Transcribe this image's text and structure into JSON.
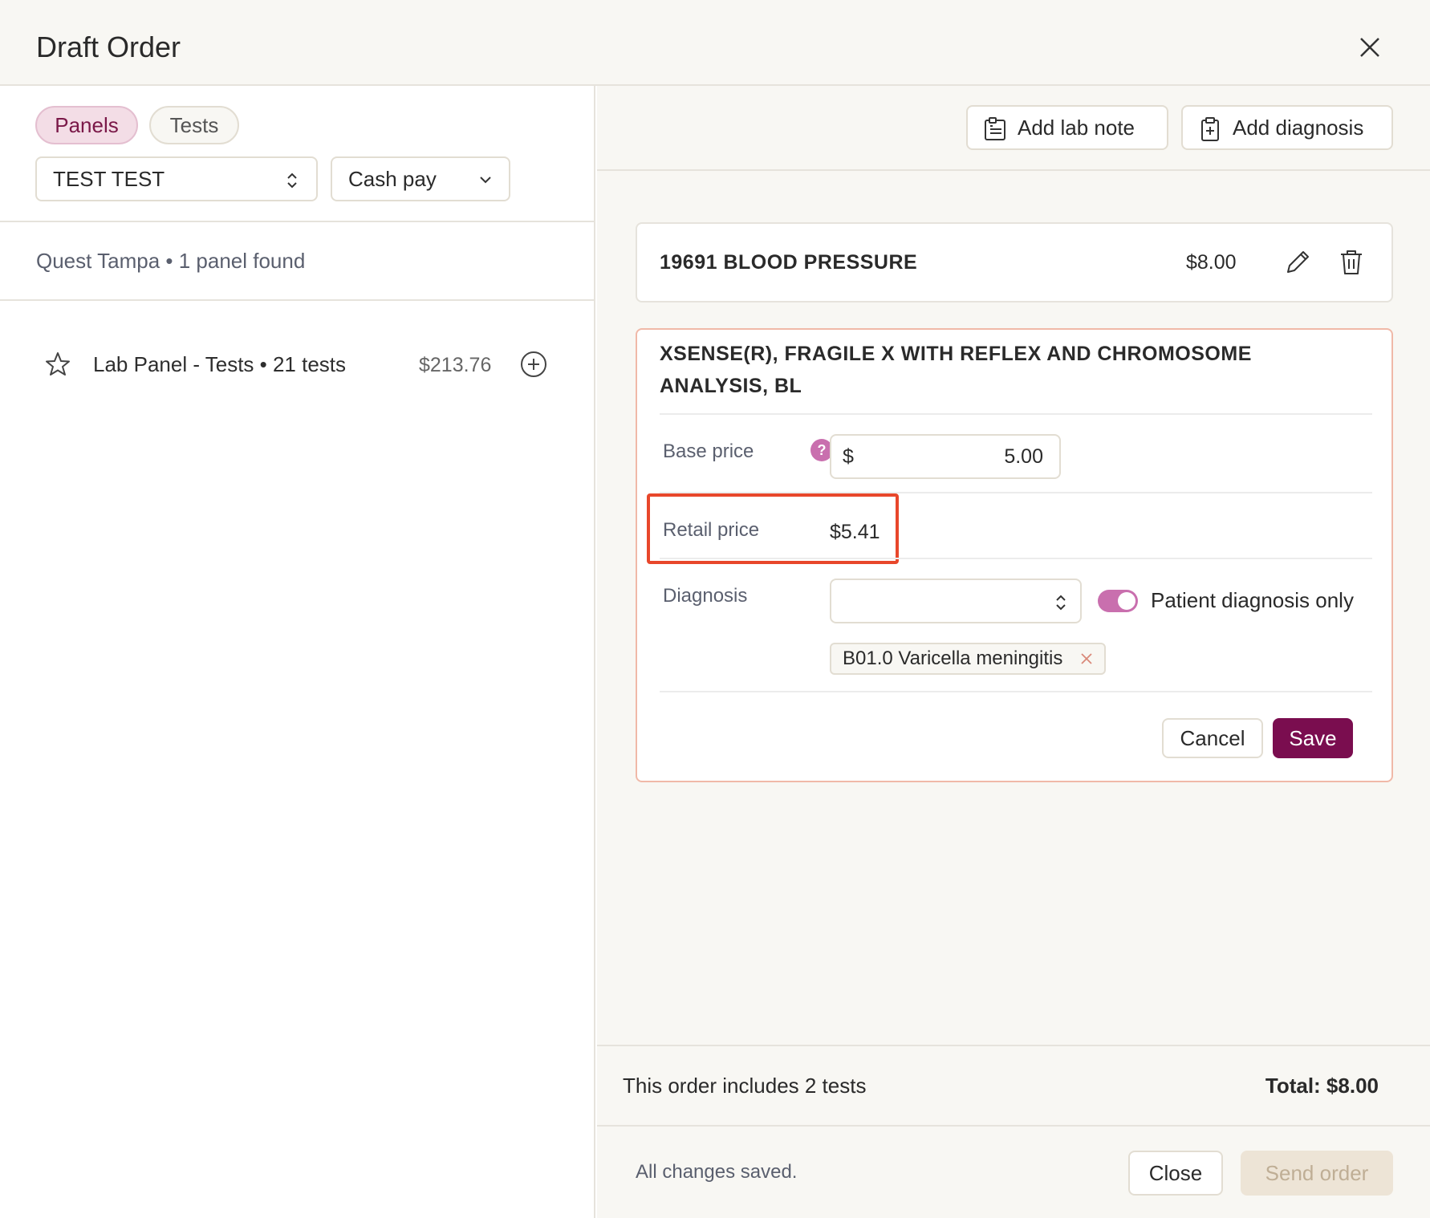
{
  "header": {
    "title": "Draft Order"
  },
  "left": {
    "tabs": [
      {
        "label": "Panels",
        "active": true
      },
      {
        "label": "Tests",
        "active": false
      }
    ],
    "patient_select": {
      "value": "TEST TEST"
    },
    "payment_select": {
      "value": "Cash pay"
    },
    "results_info": "Quest Tampa • 1 panel found",
    "panels": [
      {
        "name": "Lab Panel - Tests • 21 tests",
        "price": "$213.76"
      }
    ]
  },
  "toolbar": {
    "add_lab_note": "Add lab note",
    "add_diagnosis": "Add diagnosis"
  },
  "tests": [
    {
      "name": "19691 BLOOD PRESSURE",
      "price": "$8.00"
    }
  ],
  "editing": {
    "name": "XSENSE(R), FRAGILE X WITH REFLEX AND CHROMOSOME ANALYSIS, BL",
    "base_price_label": "Base price",
    "currency": "$",
    "base_price_value": "5.00",
    "retail_price_label": "Retail price",
    "retail_price_value": "$5.41",
    "diagnosis_label": "Diagnosis",
    "diagnosis_select_value": "",
    "patient_diagnosis_only_label": "Patient diagnosis only",
    "patient_diagnosis_only": true,
    "diagnosis_chips": [
      "B01.0 Varicella meningitis"
    ],
    "cancel_label": "Cancel",
    "save_label": "Save"
  },
  "summary": {
    "count_text": "This order includes 2 tests",
    "total_text": "Total: $8.00"
  },
  "footer": {
    "status": "All changes saved.",
    "close_label": "Close",
    "send_label": "Send order"
  },
  "colors": {
    "accent": "#7a0d4f",
    "toggle": "#c96fae",
    "highlight": "#e8472b",
    "card_border": "#f0b9a8"
  }
}
